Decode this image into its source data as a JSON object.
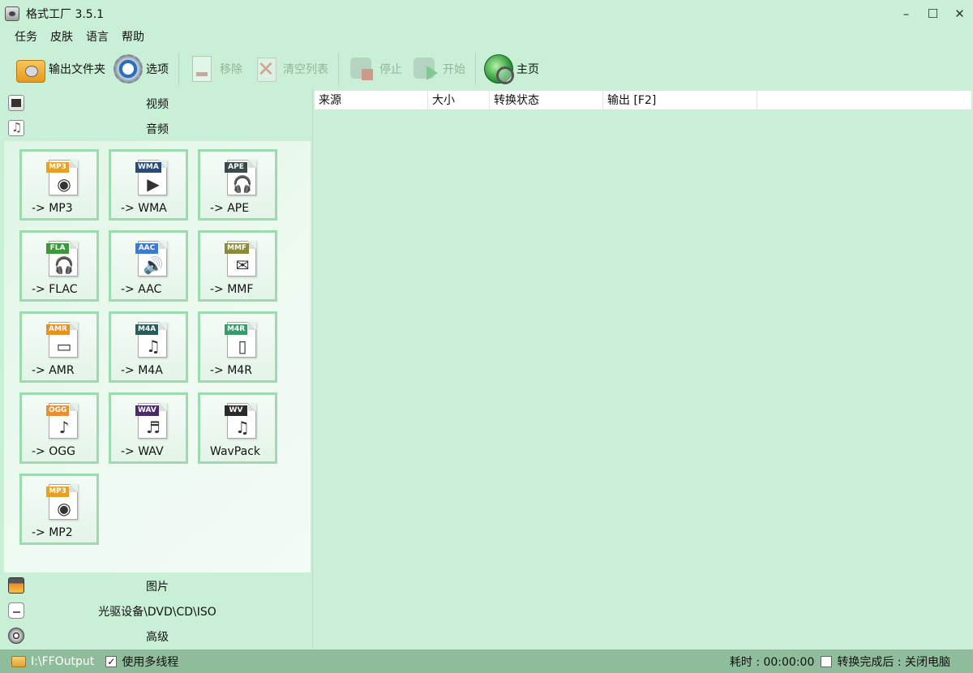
{
  "window": {
    "title": "格式工厂 3.5.1",
    "controls": {
      "minimize": "–",
      "maximize": "☐",
      "close": "✕"
    }
  },
  "menu": [
    "任务",
    "皮肤",
    "语言",
    "帮助"
  ],
  "toolbar": {
    "output_folder": "输出文件夹",
    "options": "选项",
    "remove": "移除",
    "clear_list": "清空列表",
    "stop": "停止",
    "start": "开始",
    "home": "主页"
  },
  "categories": {
    "video": "视频",
    "audio": "音频",
    "image": "图片",
    "disc": "光驱设备\\DVD\\CD\\ISO",
    "advanced": "高级"
  },
  "formats": [
    {
      "label": "-> MP3",
      "tag": "MP3",
      "tag_color": "#e8a020",
      "glyph": "◉"
    },
    {
      "label": "-> WMA",
      "tag": "WMA",
      "tag_color": "#2a4a7a",
      "glyph": "▶"
    },
    {
      "label": "-> APE",
      "tag": "APE",
      "tag_color": "#3a4a4a",
      "glyph": "🎧"
    },
    {
      "label": "-> FLAC",
      "tag": "FLA",
      "tag_color": "#3a9a3a",
      "glyph": "🎧"
    },
    {
      "label": "-> AAC",
      "tag": "AAC",
      "tag_color": "#3a7ad0",
      "glyph": "🔊"
    },
    {
      "label": "-> MMF",
      "tag": "MMF",
      "tag_color": "#8a8a3a",
      "glyph": "✉"
    },
    {
      "label": "-> AMR",
      "tag": "AMR",
      "tag_color": "#e89020",
      "glyph": "▭"
    },
    {
      "label": "-> M4A",
      "tag": "M4A",
      "tag_color": "#2a5a5a",
      "glyph": "♫"
    },
    {
      "label": "-> M4R",
      "tag": "M4R",
      "tag_color": "#3a9a6a",
      "glyph": "▯"
    },
    {
      "label": "-> OGG",
      "tag": "OGG",
      "tag_color": "#e89030",
      "glyph": "♪"
    },
    {
      "label": "-> WAV",
      "tag": "WAV",
      "tag_color": "#4a2a6a",
      "glyph": "♬"
    },
    {
      "label": "WavPack",
      "tag": "WV",
      "tag_color": "#2a2a2a",
      "glyph": "♫"
    },
    {
      "label": "-> MP2",
      "tag": "MP3",
      "tag_color": "#e8a020",
      "glyph": "◉"
    }
  ],
  "table": {
    "columns": [
      "来源",
      "大小",
      "转换状态",
      "输出 [F2]",
      ""
    ]
  },
  "status": {
    "output_path": "I:\\FFOutput",
    "multithread_checked": "✓",
    "multithread_label": "使用多线程",
    "elapsed": "耗时 : 00:00:00",
    "after_done": "转换完成后 : 关闭电脑"
  }
}
